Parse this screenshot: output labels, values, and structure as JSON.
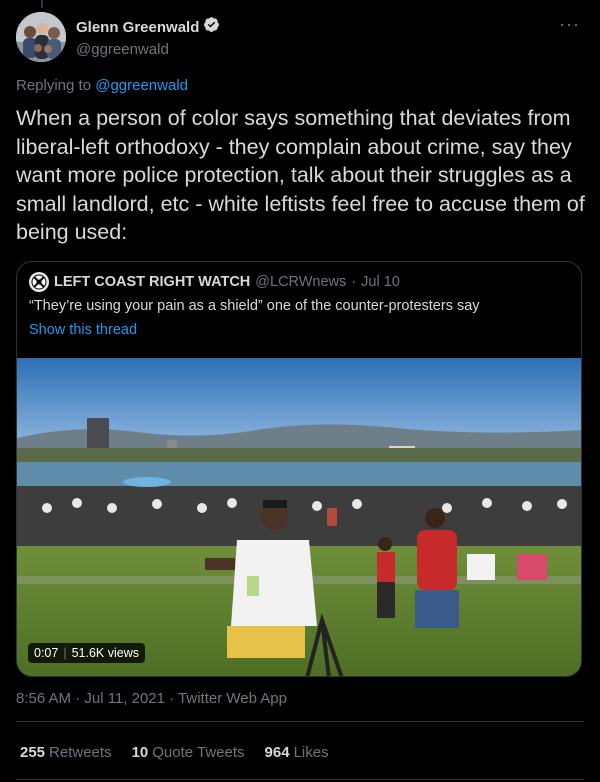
{
  "author": {
    "display_name": "Glenn Greenwald",
    "handle": "@ggreenwald",
    "verified": true
  },
  "more_icon": "···",
  "replying": {
    "prefix": "Replying to",
    "target": "@ggreenwald"
  },
  "tweet_text": "When a person of color says something that deviates from liberal-left orthodoxy - they complain about crime, say they want more police protection, talk about their struggles as a small landlord, etc - white leftists feel free to accuse them of being used:",
  "quote": {
    "name": "LEFT COAST RIGHT WATCH",
    "handle": "@LCRWnews",
    "separator": "·",
    "date": "Jul 10",
    "text": "“They’re using your pain as a shield” one of the counter-protesters say",
    "show_thread": "Show this thread",
    "video": {
      "duration": "0:07",
      "views": "51.6K views"
    }
  },
  "meta": "8:56 AM · Jul 11, 2021 · Twitter Web App",
  "stats": [
    {
      "count": "255",
      "label": "Retweets"
    },
    {
      "count": "10",
      "label": "Quote Tweets"
    },
    {
      "count": "964",
      "label": "Likes"
    }
  ],
  "colors": {
    "background": "#000000",
    "text": "#d9d9d9",
    "secondary": "#6e767d",
    "link": "#1d9bf0",
    "border": "#2f3336",
    "verified_badge": "#d9d9d9"
  },
  "icons": [
    "verified-badge-icon",
    "more-options-icon",
    "lcrw-logo-icon"
  ]
}
